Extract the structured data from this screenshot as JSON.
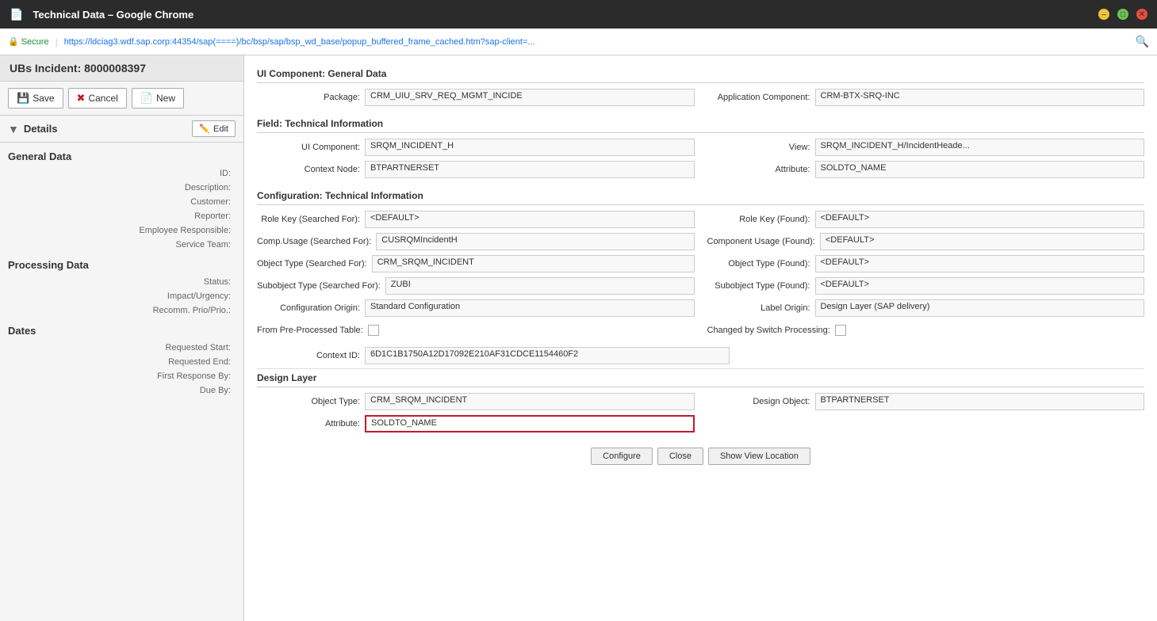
{
  "browser": {
    "title": "Technical Data – Google Chrome",
    "url": "https://ldciag3.wdf.sap.corp:44354/sap(====)/bc/bsp/sap/bsp_wd_base/popup_buffered_frame_cached.htm?sap-client=...",
    "secure_label": "Secure",
    "btn_min": "–",
    "btn_max": "□",
    "btn_close": "✕"
  },
  "left_panel": {
    "incident_header": "UBs Incident: 8000008397",
    "save_btn": "Save",
    "cancel_btn": "Cancel",
    "new_btn": "New",
    "details_label": "Details",
    "edit_label": "Edit",
    "general_data_heading": "General Data",
    "id_label": "ID:",
    "description_label": "Description:",
    "customer_label": "Customer:",
    "reporter_label": "Reporter:",
    "employee_responsible_label": "Employee Responsible:",
    "service_team_label": "Service Team:",
    "processing_data_heading": "Processing Data",
    "status_label": "Status:",
    "impact_urgency_label": "Impact/Urgency:",
    "recomm_prio_label": "Recomm. Prio/Prio.:",
    "dates_heading": "Dates",
    "requested_start_label": "Requested Start:",
    "requested_end_label": "Requested End:",
    "first_response_label": "First Response By:",
    "due_by_label": "Due By:"
  },
  "popup": {
    "ui_component_section": "UI Component:",
    "ui_component_section_value": "General Data",
    "package_label": "Package:",
    "package_value": "CRM_UIU_SRV_REQ_MGMT_INCIDE",
    "app_component_label": "Application Component:",
    "app_component_value": "CRM-BTX-SRQ-INC",
    "field_section": "Field:",
    "field_section_value": "Technical Information",
    "ui_component_label": "UI Component:",
    "ui_component_value": "SRQM_INCIDENT_H",
    "view_label": "View:",
    "view_value": "SRQM_INCIDENT_H/IncidentHeade...",
    "context_node_label": "Context Node:",
    "context_node_value": "BTPARTNERSET",
    "attribute_label": "Attribute:",
    "attribute_value": "SOLDTO_NAME",
    "config_section": "Configuration:",
    "config_section_value": "Technical Information",
    "role_key_searched_label": "Role Key (Searched For):",
    "role_key_searched_value": "<DEFAULT>",
    "role_key_found_label": "Role Key (Found):",
    "role_key_found_value": "<DEFAULT>",
    "comp_usage_searched_label": "Comp.Usage (Searched For):",
    "comp_usage_searched_value": "CUSRQMIncidentH",
    "component_usage_found_label": "Component Usage (Found):",
    "component_usage_found_value": "<DEFAULT>",
    "object_type_searched_label": "Object Type (Searched For):",
    "object_type_searched_value": "CRM_SRQM_INCIDENT",
    "object_type_found_label": "Object Type (Found):",
    "object_type_found_value": "<DEFAULT>",
    "subobject_type_searched_label": "Subobject Type (Searched For):",
    "subobject_type_searched_value": "ZUBI",
    "subobject_type_found_label": "Subobject Type (Found):",
    "subobject_type_found_value": "<DEFAULT>",
    "config_origin_label": "Configuration Origin:",
    "config_origin_value": "Standard Configuration",
    "label_origin_label": "Label Origin:",
    "label_origin_value": "Design Layer (SAP delivery)",
    "from_preprocessed_label": "From Pre-Processed Table:",
    "changed_by_switch_label": "Changed by Switch Processing:",
    "context_id_label": "Context ID:",
    "context_id_value": "6D1C1B1750A12D17092E210AF31CDCE1154460F2",
    "design_layer_heading": "Design Layer",
    "object_type_dl_label": "Object Type:",
    "object_type_dl_value": "CRM_SRQM_INCIDENT",
    "design_object_label": "Design Object:",
    "design_object_value": "BTPARTNERSET",
    "attribute_dl_label": "Attribute:",
    "attribute_dl_value": "SOLDTO_NAME",
    "configure_btn": "Configure",
    "close_btn": "Close",
    "show_view_location_btn": "Show View Location"
  }
}
